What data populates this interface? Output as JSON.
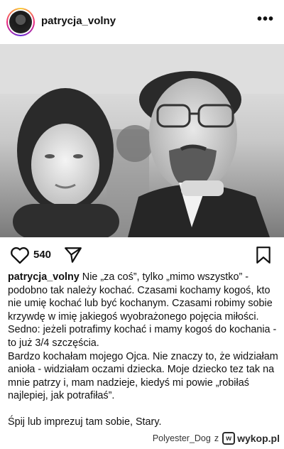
{
  "header": {
    "username": "patrycja_volny",
    "more_icon": "more-horizontal-icon"
  },
  "post": {
    "image": "black-and-white-photo"
  },
  "actions": {
    "likes": "540",
    "like_icon": "heart-icon",
    "share_icon": "send-icon",
    "save_icon": "bookmark-icon"
  },
  "caption": {
    "username": "patrycja_volny",
    "paragraph1": " Nie „za coś”, tylko „mimo wszystko” - podobno tak należy kochać. Czasami kochamy kogoś, kto nie umię kochać lub być kochanym. Czasami robimy sobie krzywdę w imię jakiegoś wyobrażonego pojęcia miłości. Sedno: jeżeli potrafimy kochać i mamy kogoś do kochania - to już 3/4 szczęścia.",
    "paragraph2": "Bardzo kochałam mojego Ojca. Nie znaczy to, że widziałam anioła - widziałam oczami dziecka. Moje dziecko tez tak na mnie patrzy i, mam nadzieje, kiedyś mi powie „robiłaś najlepiej, jak potrafiłaś”.",
    "paragraph3": "Śpij lub imprezuj tam sobie, Stary."
  },
  "watermark": {
    "user": "Polyester_Dog",
    "z": "z",
    "site": "wykop.pl"
  }
}
